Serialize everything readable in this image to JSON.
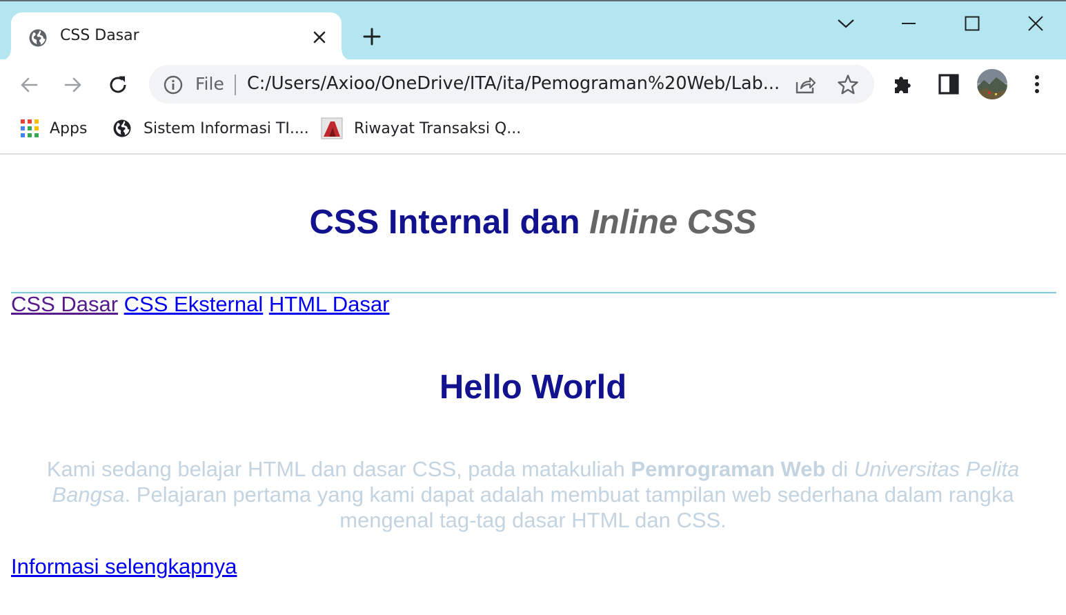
{
  "browser": {
    "tab": {
      "title": "CSS Dasar",
      "favicon": "globe-icon"
    },
    "omnibox": {
      "scheme_label": "File",
      "url": "C:/Users/Axioo/OneDrive/ITA/ita/Pemograman%20Web/Lab..."
    },
    "bookmarks": [
      {
        "label": "Apps",
        "icon": "apps-grid-icon"
      },
      {
        "label": "Sistem Informasi TI....",
        "icon": "globe-icon"
      },
      {
        "label": "Riwayat Transaksi Q...",
        "icon": "site-favicon"
      }
    ]
  },
  "page": {
    "heading": {
      "main": "CSS Internal dan ",
      "italic": "Inline CSS"
    },
    "nav_links": [
      {
        "label": "CSS Dasar",
        "visited": true
      },
      {
        "label": "CSS Eksternal",
        "visited": false
      },
      {
        "label": "HTML Dasar",
        "visited": false
      }
    ],
    "subheading": "Hello World",
    "paragraph": {
      "part1": "Kami sedang belajar HTML dan dasar CSS, pada matakuliah ",
      "bold": "Pemrograman Web",
      "part2": " di ",
      "italic": "Universitas Pelita Bangsa",
      "part3": ". Pelajaran pertama yang kami dapat adalah membuat tampilan web sederhana dalam rangka mengenal tag-tag dasar HTML dan CSS."
    },
    "more_link": "Informasi selengkapnya"
  },
  "colors": {
    "tabstrip": "#b4e6f1",
    "heading": "#12128e",
    "heading_italic": "#666666",
    "paragraph": "#c3d3e0",
    "link": "#0000ee",
    "visited_link": "#551a8b",
    "hr": "#7fc9d8"
  }
}
